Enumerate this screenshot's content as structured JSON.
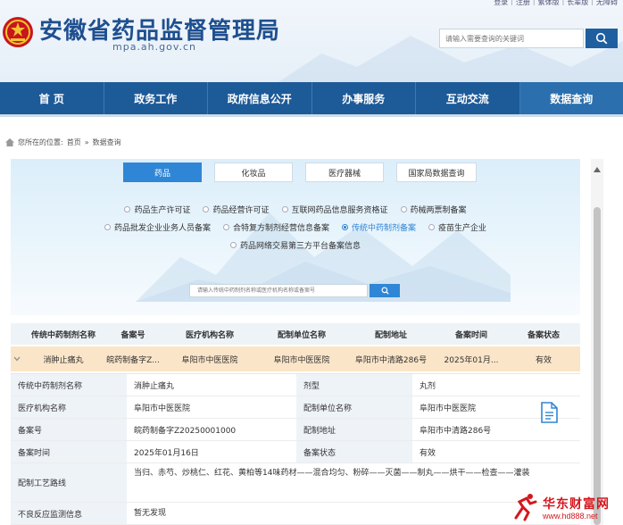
{
  "toplinks": [
    "登录",
    "注册",
    "繁体版",
    "长辈版",
    "无障碍"
  ],
  "site": {
    "title": "安徽省药品监督管理局",
    "domain": "mpa.ah.gov.cn",
    "search_placeholder": "请输入需要查询的关键词"
  },
  "nav": [
    {
      "label": "首 页"
    },
    {
      "label": "政务工作"
    },
    {
      "label": "政府信息公开"
    },
    {
      "label": "办事服务"
    },
    {
      "label": "互动交流"
    },
    {
      "label": "数据查询",
      "active": true
    }
  ],
  "breadcrumb": {
    "prefix": "您所在的位置:",
    "home": "首页",
    "sep": "»",
    "current": "数据查询"
  },
  "tabs": [
    {
      "label": "药品",
      "active": true
    },
    {
      "label": "化妆品"
    },
    {
      "label": "医疗器械"
    },
    {
      "label": "国家局数据查询"
    }
  ],
  "radio_rows": [
    [
      "药品生产许可证",
      "药品经营许可证",
      "互联网药品信息服务资格证",
      "药械两票制备案"
    ],
    [
      "药品批发企业业务人员备案",
      "合特复方制剂经营信息备案",
      "传统中药制剂备案",
      "疫苗生产企业"
    ],
    [
      "药品网络交易第三方平台备案信息"
    ]
  ],
  "radio_selected": "传统中药制剂备案",
  "query": {
    "placeholder": "请输入传统中药制剂名称或医疗机构名称或备案号"
  },
  "table": {
    "headers": [
      "传统中药制剂名称",
      "备案号",
      "医疗机构名称",
      "配制单位名称",
      "配制地址",
      "备案时间",
      "备案状态"
    ],
    "row": [
      "消肿止痛丸",
      "皖药制备字Z...",
      "阜阳市中医医院",
      "阜阳市中医医院",
      "阜阳市中清路286号",
      "2025年01月...",
      "有效"
    ]
  },
  "details": [
    {
      "label": "传统中药制剂名称",
      "value": "消肿止痛丸",
      "label2": "剂型",
      "value2": "丸剂"
    },
    {
      "label": "医疗机构名称",
      "value": "阜阳市中医医院",
      "label2": "配制单位名称",
      "value2": "阜阳市中医医院"
    },
    {
      "label": "备案号",
      "value": "皖药制备字Z20250001000",
      "label2": "配制地址",
      "value2": "阜阳市中清路286号"
    },
    {
      "label": "备案时间",
      "value": "2025年01月16日",
      "label2": "备案状态",
      "value2": "有效"
    }
  ],
  "process": {
    "label": "配制工艺路线",
    "value": "当归、赤芍、炒桃仁、红花、黄柏等14味药材——混合均匀、粉碎——灭菌——制丸——烘干——检查——灌装"
  },
  "adverse": {
    "label": "不良反应监测信息",
    "value": "暂无发现"
  },
  "watermark": {
    "text": "华东财富网",
    "url": "www.hd888.net"
  }
}
